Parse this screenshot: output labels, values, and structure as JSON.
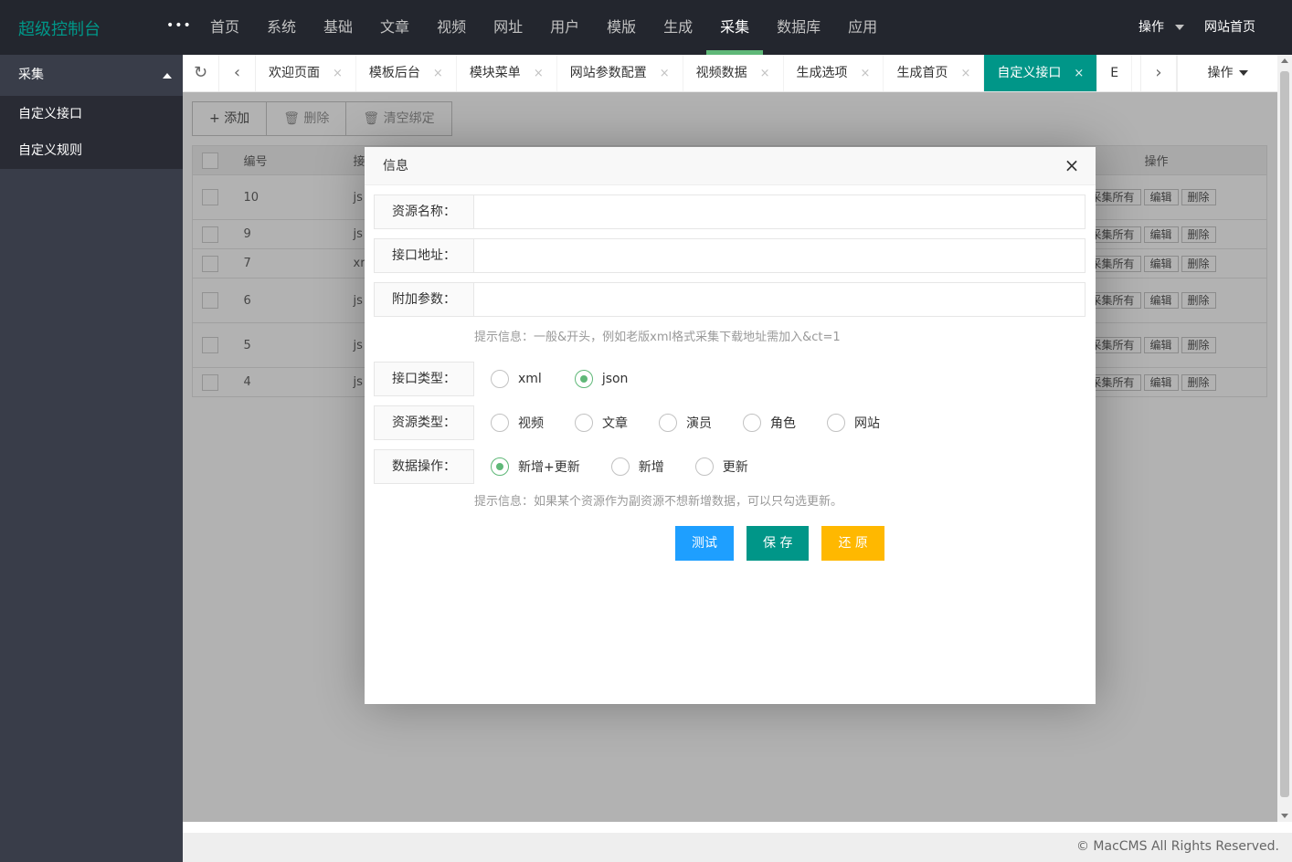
{
  "app": {
    "logo": "超级控制台",
    "more": "•••"
  },
  "top_nav": [
    "首页",
    "系统",
    "基础",
    "文章",
    "视频",
    "网址",
    "用户",
    "模版",
    "生成",
    "采集",
    "数据库",
    "应用"
  ],
  "top_nav_active": "采集",
  "top_right": {
    "ops": "操作",
    "site_home": "网站首页"
  },
  "sidebar": {
    "group": "采集",
    "items": [
      "自定义接口",
      "自定义规则"
    ]
  },
  "tabs": [
    {
      "label": "欢迎页面",
      "close": "×"
    },
    {
      "label": "模板后台",
      "close": "×"
    },
    {
      "label": "模块菜单",
      "close": "×"
    },
    {
      "label": "网站参数配置",
      "close": "×"
    },
    {
      "label": "视频数据",
      "close": "×"
    },
    {
      "label": "生成选项",
      "close": "×"
    },
    {
      "label": "生成首页",
      "close": "×"
    },
    {
      "label": "自定义接口",
      "close": "×"
    },
    {
      "label": "E",
      "close": ""
    }
  ],
  "tab_ops": "操作",
  "toolbar": {
    "add": "添加",
    "delete": "删除",
    "clear": "清空绑定"
  },
  "table": {
    "headers": {
      "id": "编号",
      "api": "接",
      "ops": "操作"
    },
    "rows": [
      {
        "id": "10",
        "api": "js",
        "collect": "采集所有",
        "edit": "编辑",
        "del": "删除"
      },
      {
        "id": "9",
        "api": "js",
        "collect": "采集所有",
        "edit": "编辑",
        "del": "删除"
      },
      {
        "id": "7",
        "api": "xr",
        "collect": "采集所有",
        "edit": "编辑",
        "del": "删除"
      },
      {
        "id": "6",
        "api": "js",
        "collect": "采集所有",
        "edit": "编辑",
        "del": "删除"
      },
      {
        "id": "5",
        "api": "js",
        "collect": "采集所有",
        "edit": "编辑",
        "del": "删除"
      },
      {
        "id": "4",
        "api": "js",
        "collect": "采集所有",
        "edit": "编辑",
        "del": "删除"
      }
    ]
  },
  "modal": {
    "title": "信息",
    "close": "×",
    "fields": {
      "name_label": "资源名称：",
      "url_label": "接口地址：",
      "params_label": "附加参数："
    },
    "hint1": "提示信息：一般&开头，例如老版xml格式采集下载地址需加入&ct=1",
    "api_type": {
      "label": "接口类型：",
      "options": [
        "xml",
        "json"
      ],
      "selected": "json"
    },
    "res_type": {
      "label": "资源类型：",
      "options": [
        "视频",
        "文章",
        "演员",
        "角色",
        "网站"
      ],
      "selected": ""
    },
    "data_op": {
      "label": "数据操作：",
      "options": [
        "新增+更新",
        "新增",
        "更新"
      ],
      "selected": "新增+更新"
    },
    "hint2": "提示信息：如果某个资源作为副资源不想新增数据，可以只勾选更新。",
    "buttons": {
      "test": "测试",
      "save": "保 存",
      "reset": "还 原"
    }
  },
  "footer": "© MacCMS All Rights Reserved.",
  "colors": {
    "accent": "#009688",
    "radio_on": "#5FB878",
    "test": "#1E9FFF",
    "reset": "#FFB800"
  }
}
